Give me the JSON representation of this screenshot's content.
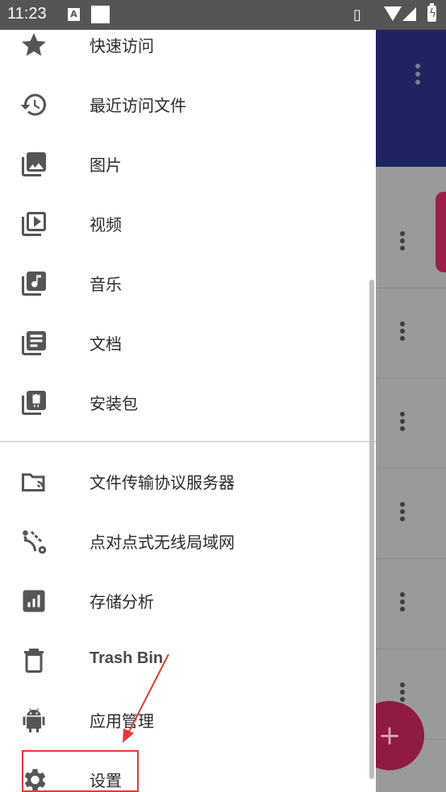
{
  "status_bar": {
    "time": "11:23",
    "icons": [
      "font-a-icon",
      "white-square-icon",
      "vibrate-icon",
      "wifi-icon",
      "signal-icon",
      "battery-charging-icon"
    ]
  },
  "drawer": {
    "items": [
      {
        "label": "快速访问",
        "icon": "star-icon"
      },
      {
        "label": "最近访问文件",
        "icon": "history-icon"
      },
      {
        "label": "图片",
        "icon": "image-library-icon"
      },
      {
        "label": "视频",
        "icon": "video-library-icon"
      },
      {
        "label": "音乐",
        "icon": "music-library-icon"
      },
      {
        "label": "文档",
        "icon": "document-library-icon"
      },
      {
        "label": "安装包",
        "icon": "apk-library-icon"
      },
      {
        "label": "文件传输协议服务器",
        "icon": "ftp-folder-icon"
      },
      {
        "label": "点对点式无线局域网",
        "icon": "wifi-p2p-icon"
      },
      {
        "label": "存储分析",
        "icon": "storage-analysis-icon"
      },
      {
        "label": "Trash Bin",
        "icon": "trash-icon"
      },
      {
        "label": "应用管理",
        "icon": "android-icon"
      },
      {
        "label": "设置",
        "icon": "gear-icon"
      }
    ]
  },
  "background_app": {
    "fab_label": "+"
  },
  "colors": {
    "highlight": "#e53935",
    "icon": "#555555",
    "toolbar": "#1f2460",
    "fab": "#8f1a42"
  }
}
